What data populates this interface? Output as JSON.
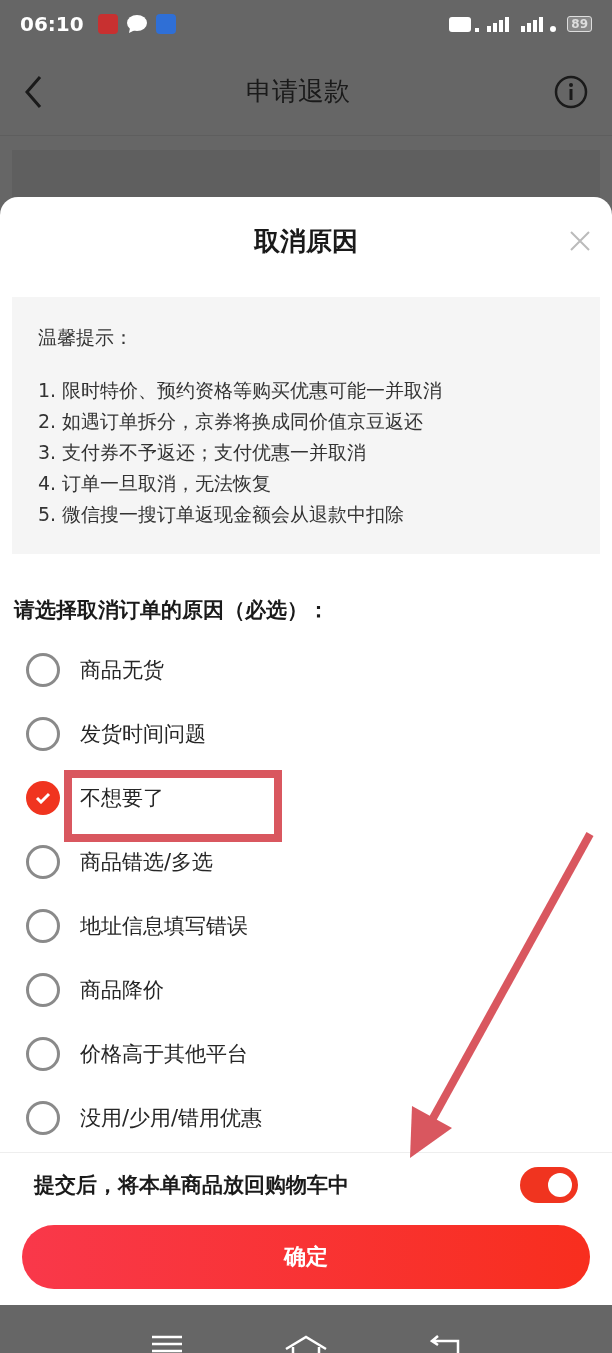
{
  "status_bar": {
    "time": "06:10",
    "battery": "89"
  },
  "header": {
    "title": "申请退款"
  },
  "sheet": {
    "title": "取消原因",
    "tips": {
      "heading": "温馨提示：",
      "items": [
        "1.  限时特价、预约资格等购买优惠可能一并取消",
        "2.  如遇订单拆分，京券将换成同价值京豆返还",
        "3.  支付券不予返还；支付优惠一并取消",
        "4.  订单一旦取消，无法恢复",
        "5.  微信搜一搜订单返现金额会从退款中扣除"
      ]
    },
    "question": "请选择取消订单的原因（必选）：",
    "reasons": [
      {
        "label": "商品无货",
        "selected": false
      },
      {
        "label": "发货时间问题",
        "selected": false
      },
      {
        "label": "不想要了",
        "selected": true
      },
      {
        "label": "商品错选/多选",
        "selected": false
      },
      {
        "label": "地址信息填写错误",
        "selected": false
      },
      {
        "label": "商品降价",
        "selected": false
      },
      {
        "label": "价格高于其他平台",
        "selected": false
      },
      {
        "label": "没用/少用/错用优惠",
        "selected": false
      }
    ],
    "return_to_cart": {
      "label": "提交后，将本单商品放回购物车中",
      "on": true
    },
    "confirm_button": "确定"
  }
}
